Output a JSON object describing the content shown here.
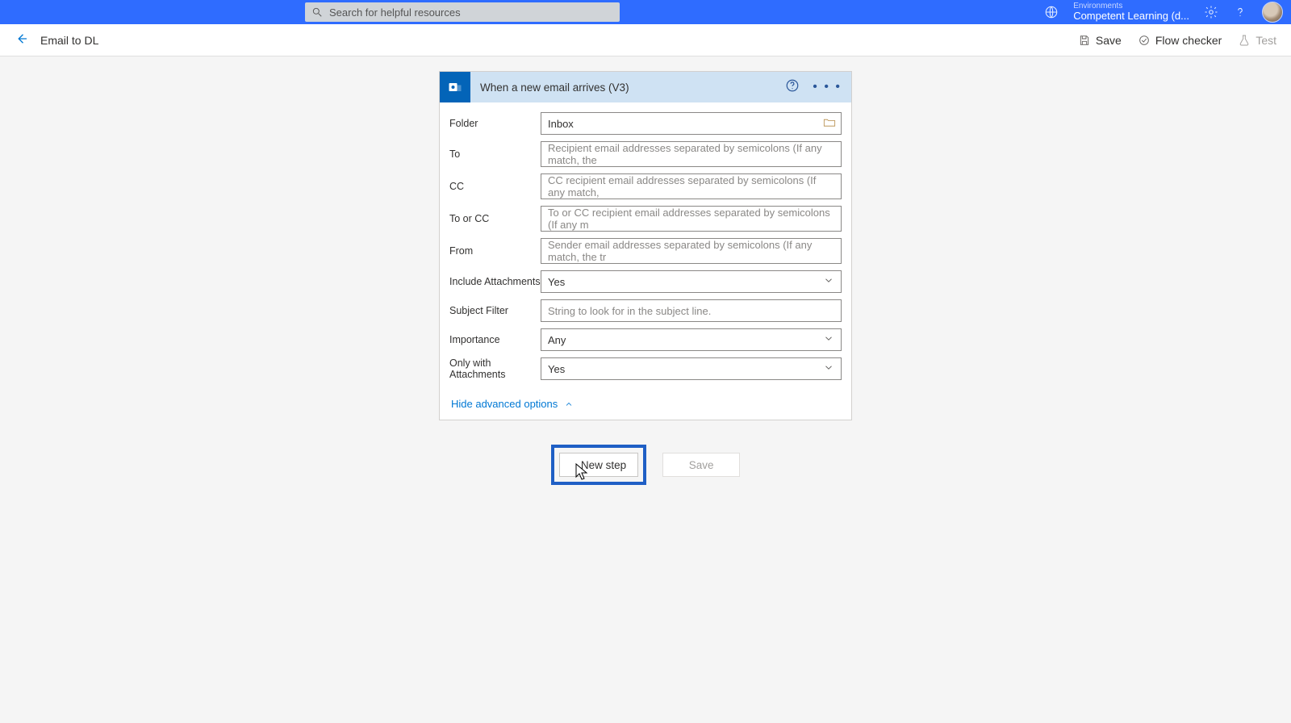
{
  "topbar": {
    "search_placeholder": "Search for helpful resources",
    "env_label": "Environments",
    "env_name": "Competent Learning (d..."
  },
  "subheader": {
    "flow_title": "Email to DL",
    "save": "Save",
    "flow_checker": "Flow checker",
    "test": "Test"
  },
  "trigger": {
    "title": "When a new email arrives (V3)",
    "fields": {
      "folder_label": "Folder",
      "folder_value": "Inbox",
      "to_label": "To",
      "to_placeholder": "Recipient email addresses separated by semicolons (If any match, the",
      "cc_label": "CC",
      "cc_placeholder": "CC recipient email addresses separated by semicolons (If any match,",
      "tocc_label": "To or CC",
      "tocc_placeholder": "To or CC recipient email addresses separated by semicolons (If any m",
      "from_label": "From",
      "from_placeholder": "Sender email addresses separated by semicolons (If any match, the tr",
      "include_att_label": "Include Attachments",
      "include_att_value": "Yes",
      "subject_label": "Subject Filter",
      "subject_placeholder": "String to look for in the subject line.",
      "importance_label": "Importance",
      "importance_value": "Any",
      "only_att_label": "Only with Attachments",
      "only_att_value": "Yes"
    },
    "advanced_toggle": "Hide advanced options"
  },
  "buttons": {
    "new_step": "New step",
    "save": "Save"
  }
}
